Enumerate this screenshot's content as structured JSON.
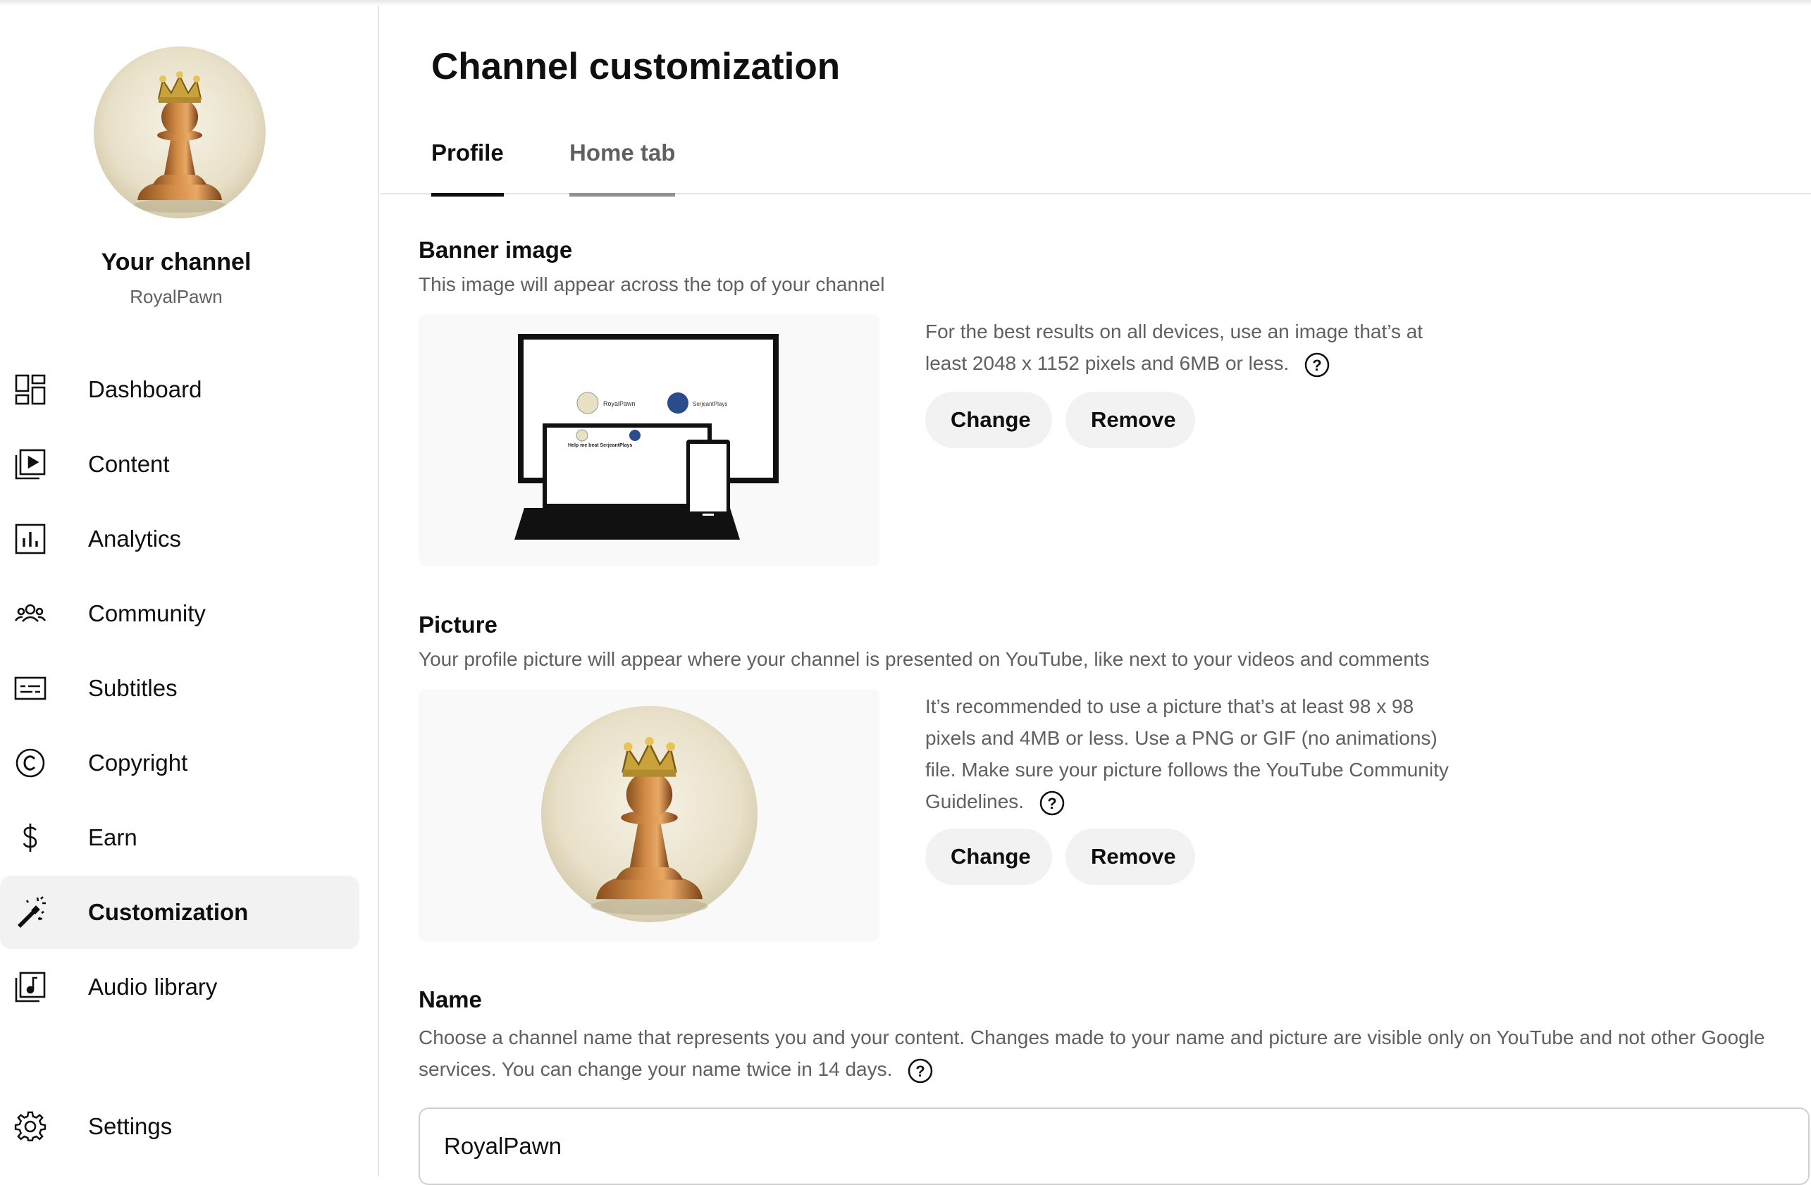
{
  "sidebar": {
    "channel_title": "Your channel",
    "channel_handle": "RoyalPawn",
    "items": [
      {
        "label": "Dashboard",
        "icon": "dashboard-icon"
      },
      {
        "label": "Content",
        "icon": "content-icon"
      },
      {
        "label": "Analytics",
        "icon": "analytics-icon"
      },
      {
        "label": "Community",
        "icon": "community-icon"
      },
      {
        "label": "Subtitles",
        "icon": "subtitles-icon"
      },
      {
        "label": "Copyright",
        "icon": "copyright-icon"
      },
      {
        "label": "Earn",
        "icon": "dollar-icon"
      },
      {
        "label": "Customization",
        "icon": "magic-wand-icon",
        "active": true
      },
      {
        "label": "Audio library",
        "icon": "audio-library-icon"
      }
    ],
    "settings_label": "Settings"
  },
  "main": {
    "title": "Channel customization",
    "tabs": [
      {
        "label": "Profile",
        "active": true
      },
      {
        "label": "Home tab",
        "active": false
      }
    ],
    "banner": {
      "title": "Banner image",
      "description": "This image will appear across the top of your channel",
      "info": "For the best results on all devices, use an image that’s at least 2048 x 1152 pixels and 6MB or less.",
      "change_label": "Change",
      "remove_label": "Remove",
      "preview_name_1": "RoyalPawn",
      "preview_name_2": "SerjeantPlays",
      "preview_heading": "Help me beat SerjeantPlays"
    },
    "picture": {
      "title": "Picture",
      "description": "Your profile picture will appear where your channel is presented on YouTube, like next to your videos and comments",
      "info": "It’s recommended to use a picture that’s at least 98 x 98 pixels and 4MB or less. Use a PNG or GIF (no animations) file. Make sure your picture follows the YouTube Community Guidelines.",
      "change_label": "Change",
      "remove_label": "Remove"
    },
    "name": {
      "title": "Name",
      "description": "Choose a channel name that represents you and your content. Changes made to your name and picture are visible only on YouTube and not other Google services. You can change your name twice in 14 days.",
      "value": "RoyalPawn"
    }
  },
  "colors": {
    "text_primary": "#0f0f0f",
    "text_secondary": "#606060",
    "button_bg": "#f2f2f2",
    "active_nav_bg": "#f2f2f2"
  }
}
